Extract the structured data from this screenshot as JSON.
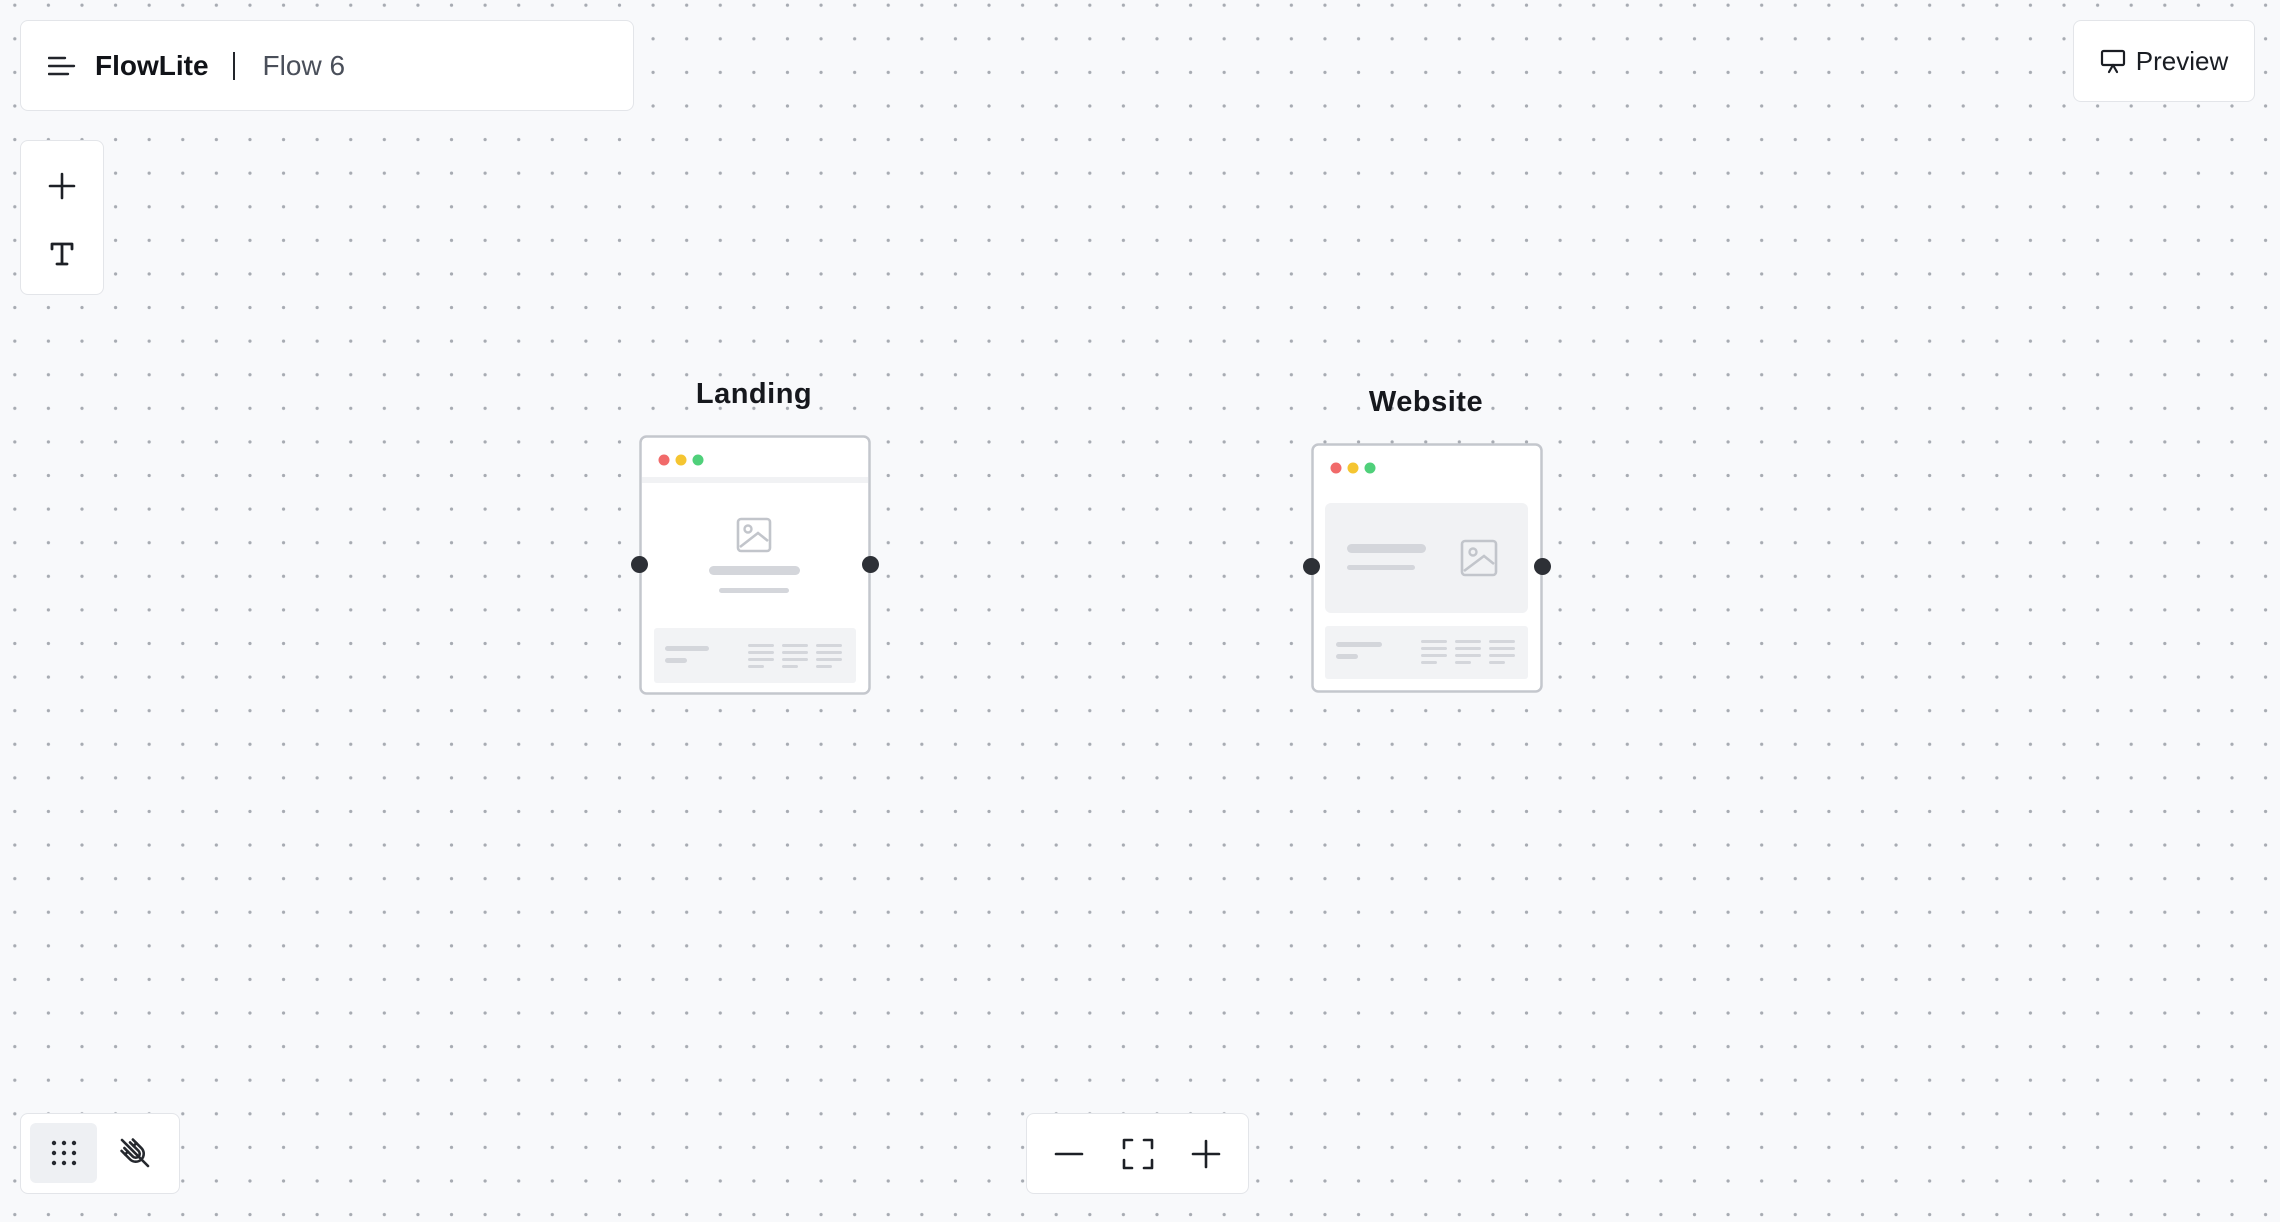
{
  "header": {
    "app_name": "FlowLite",
    "flow_name": "Flow 6",
    "menu_icon": "menu-icon"
  },
  "toolbar": {
    "tools": [
      {
        "name": "add-node",
        "icon": "plus-icon"
      },
      {
        "name": "add-text",
        "icon": "text-icon"
      }
    ]
  },
  "preview": {
    "label": "Preview",
    "icon": "presentation-icon"
  },
  "canvas": {
    "nodes": [
      {
        "title": "Landing",
        "layout": "landing"
      },
      {
        "title": "Website",
        "layout": "website"
      }
    ]
  },
  "bottom_tools": [
    {
      "name": "grid-toggle",
      "icon": "grid-dots-icon",
      "active": true
    },
    {
      "name": "snap-toggle",
      "icon": "magnet-off-icon",
      "active": false
    }
  ],
  "zoom_controls": [
    {
      "name": "zoom-out",
      "icon": "minus-icon"
    },
    {
      "name": "fit-view",
      "icon": "fit-screen-icon"
    },
    {
      "name": "zoom-in",
      "icon": "plus-icon"
    }
  ],
  "colors": {
    "canvas_bg": "#f8f9fb",
    "dot": "#a7abb2",
    "handle": "#2d3036",
    "window_red": "#f16a6a",
    "window_yellow": "#f5c531",
    "window_green": "#4fd07a",
    "placeholder": "#d4d6db"
  }
}
